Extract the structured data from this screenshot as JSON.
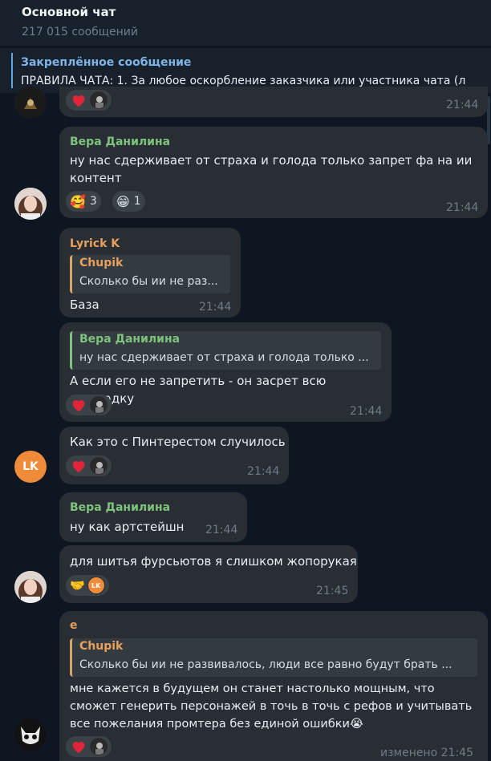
{
  "header": {
    "title": "Основной чат",
    "subtitle": "217 015 сообщений"
  },
  "pinned": {
    "title": "Закреплённое сообщение",
    "text": "ПРАВИЛА ЧАТА:  1. За любое оскорбление заказчика или участника чата  (л"
  },
  "colors": {
    "accent_green": "#7ec27d",
    "accent_orange": "#e8a05d",
    "reply_bar": "#d9a566",
    "bubble": "#282e33",
    "background": "#0e1621"
  },
  "messages": [
    {
      "time": "21:44",
      "reactions": [
        {
          "icon": "heart-icon"
        }
      ]
    },
    {
      "sender": "Вера Данилина",
      "lines": [
        "ну нас сдерживает от страха и голода только запрет фа на ии",
        "контент"
      ],
      "time": "21:44",
      "reactions": [
        {
          "icon": "face-hearts-icon",
          "count": "3"
        },
        {
          "icon": "grin-icon",
          "count": "1"
        }
      ]
    },
    {
      "sender": "Lyrick K",
      "reply": {
        "name": "Chupik",
        "text": "Сколько бы ии не раз..."
      },
      "text": "База",
      "time": "21:44"
    },
    {
      "reply": {
        "name": "Вера Данилина",
        "text": "ну нас сдерживает от страха и голода только ..."
      },
      "text": "А если его не запретить - он засрет всю площадку",
      "time": "21:44",
      "reactions": [
        {
          "icon": "heart-icon"
        }
      ]
    },
    {
      "text": "Как это с Пинтерестом случилось",
      "time": "21:44",
      "avatar": "LK",
      "reactions": [
        {
          "icon": "heart-icon"
        }
      ]
    },
    {
      "sender": "Вера Данилина",
      "text": "ну как артстейшн",
      "time": "21:44"
    },
    {
      "text": "для шитья фурсьютов я слишком жопорукая",
      "time": "21:45",
      "reactions": [
        {
          "icon": "handshake-icon",
          "avatar": "LK"
        }
      ]
    },
    {
      "sender": "е",
      "reply": {
        "name": "Chupik",
        "text": "Сколько бы ии не развивалось,  люди все равно будут брать ..."
      },
      "lines": [
        "мне кажется в будущем он станет настолько мощным, что",
        "сможет генерить персонажей в точь в точь с рефов и учитывать",
        "все пожелания промтера без единой ошибки😭"
      ],
      "time": "изменено 21:45",
      "reactions": [
        {
          "icon": "heart-icon"
        }
      ]
    }
  ]
}
